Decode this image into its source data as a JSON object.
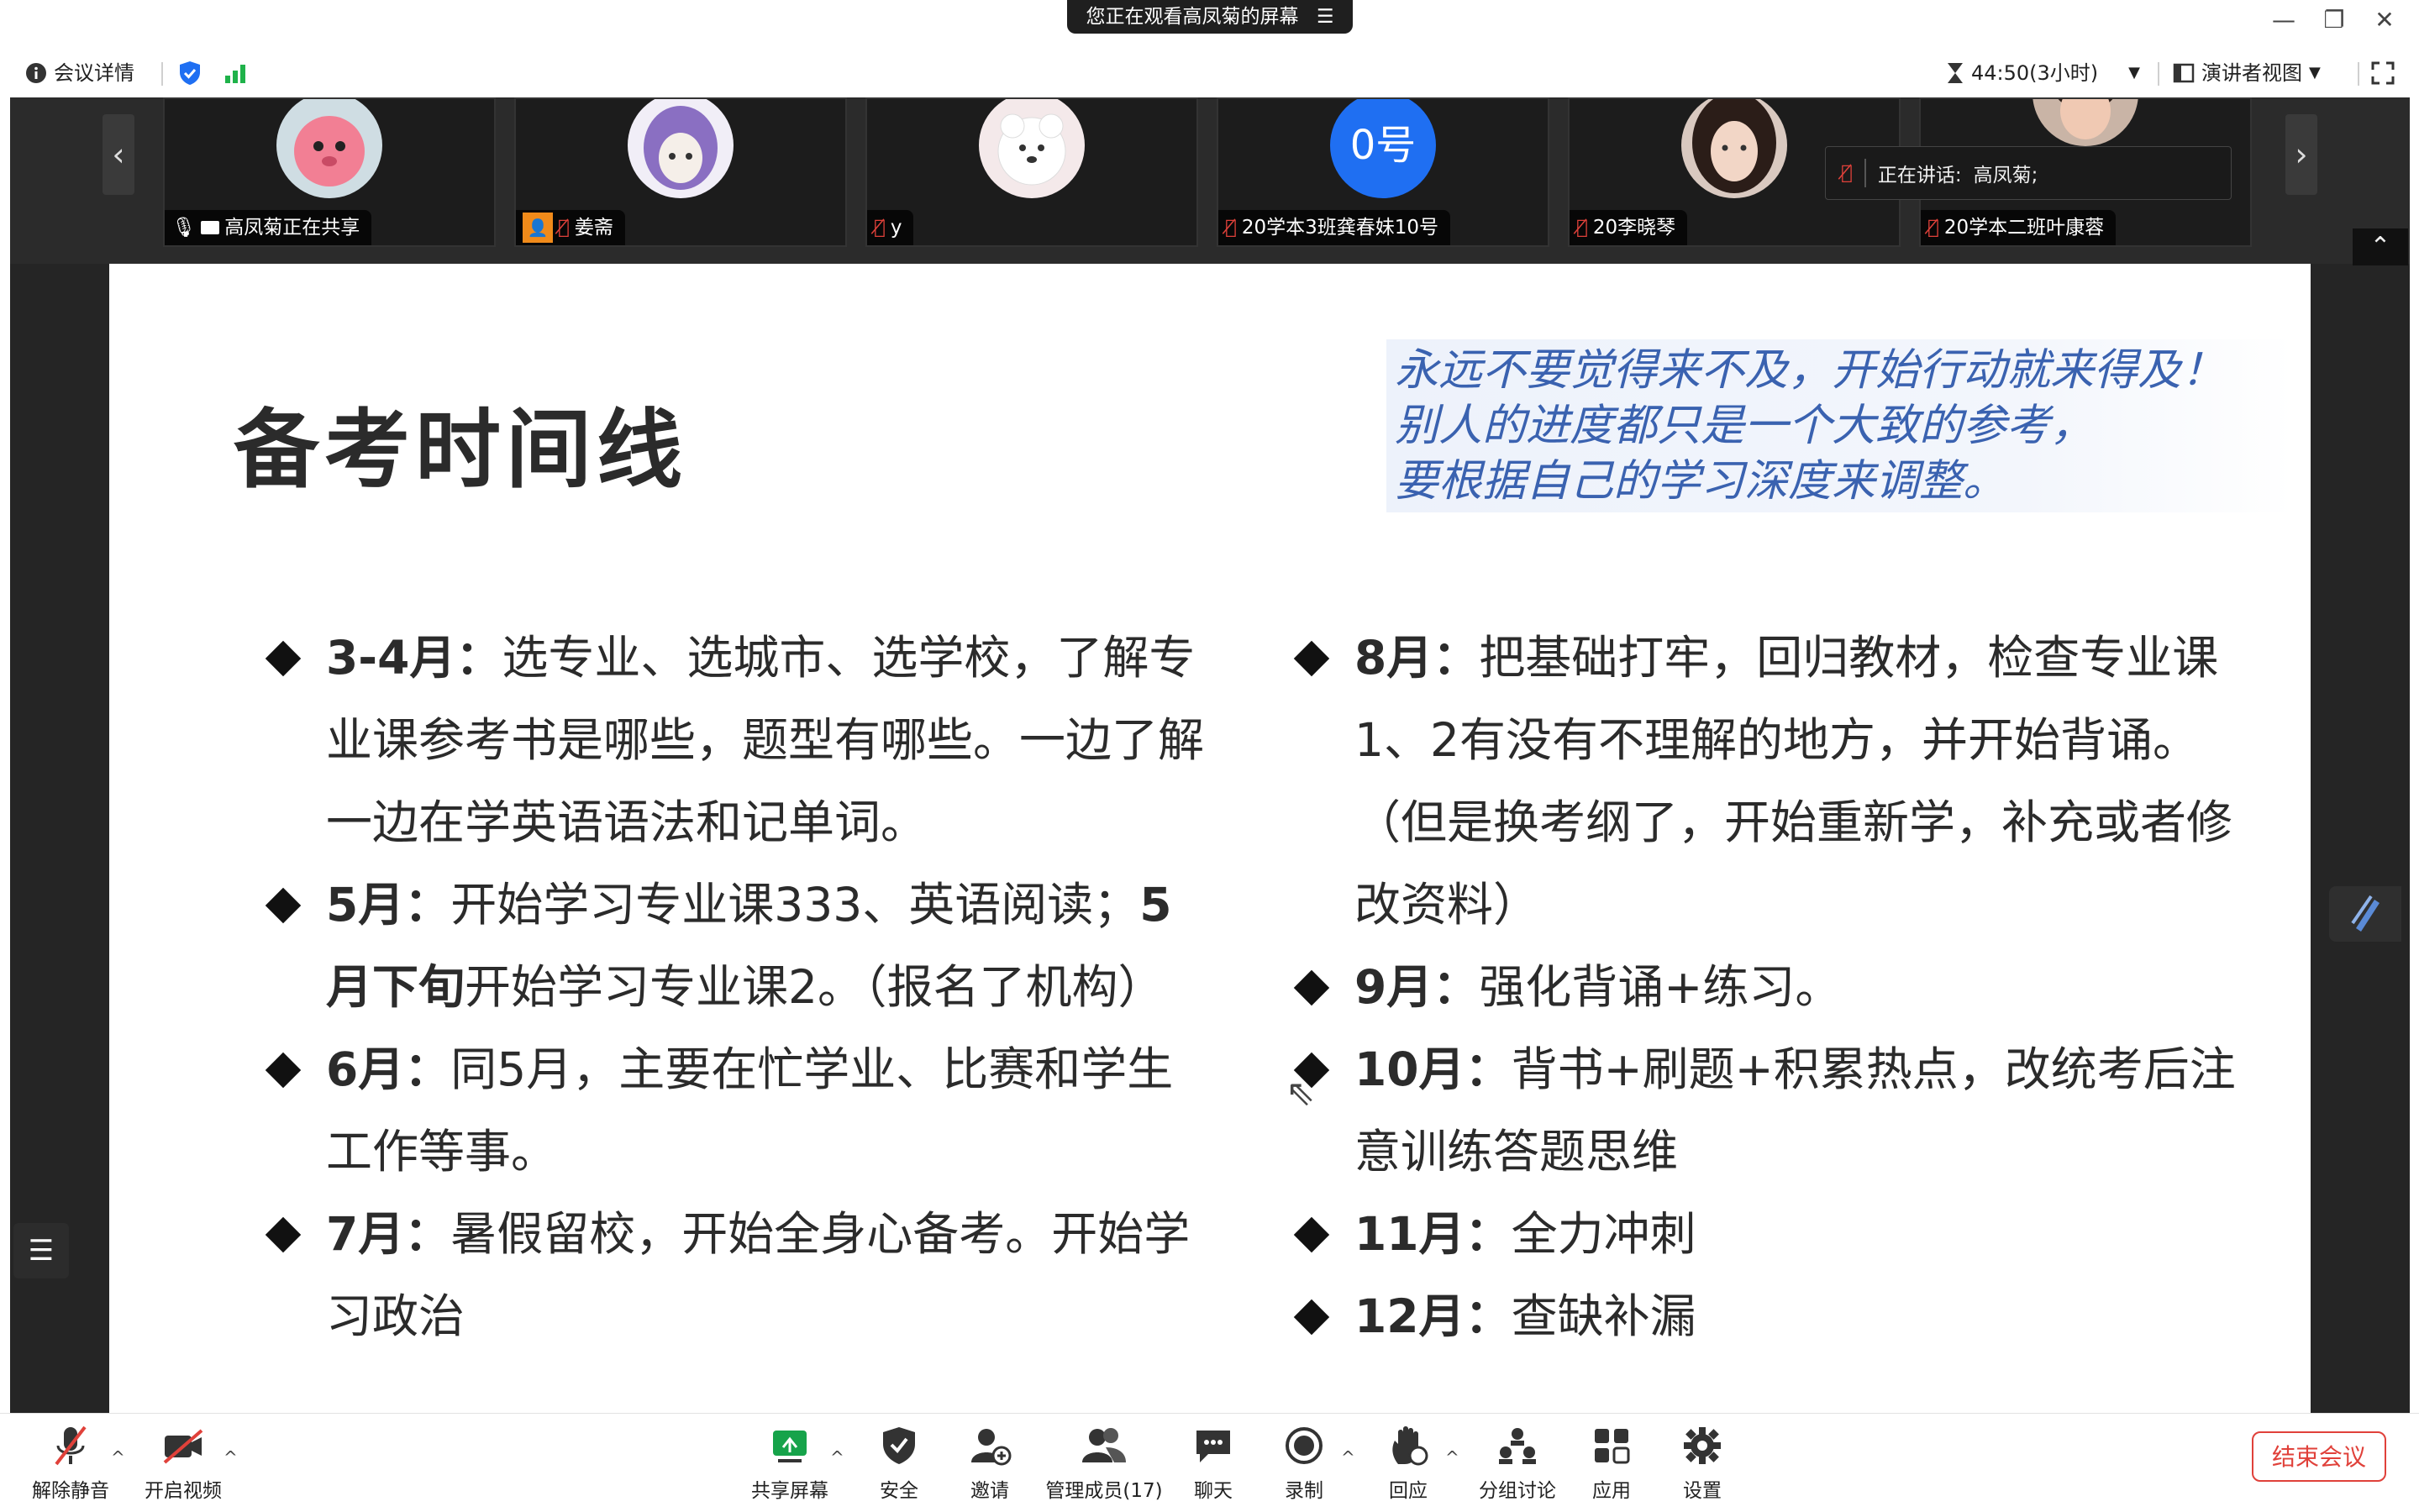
{
  "window": {
    "share_notice": "您正在观看高凤菊的屏幕",
    "minimize": "—",
    "restore": "❐",
    "close": "✕"
  },
  "infobar": {
    "meeting_details": "会议详情",
    "timer": "44:50(3小时)",
    "view_mode": "演讲者视图"
  },
  "participants": [
    {
      "name": "高凤菊正在共享",
      "avatar": "pink-creature"
    },
    {
      "name": "姜斋",
      "avatar": "anime-girl"
    },
    {
      "name": "y",
      "avatar": "white-dog"
    },
    {
      "name": "20学本3班龚春妹10号",
      "avatar": "text-0hao",
      "avatar_text": "0号"
    },
    {
      "name": "20李晓琴",
      "avatar": "photo-girl"
    },
    {
      "name": "20学本二班叶康蓉",
      "avatar": "photo-boy"
    }
  ],
  "speaking": {
    "label": "正在讲话:",
    "name": "高凤菊;"
  },
  "slide": {
    "title": "备考时间线",
    "quote": [
      "永远不要觉得来不及，开始行动就来得及！",
      "别人的进度都只是一个大致的参考，",
      "要根据自己的学习深度来调整。"
    ],
    "left_items": [
      {
        "month": "3-4月",
        "sep": "：",
        "text": "选专业、选城市、选学校，了解专业课参考书是哪些，题型有哪些。一边了解一边在学英语语法和记单词。"
      },
      {
        "month": "5月",
        "sep": "：",
        "text": "开始学习专业课333、英语阅读；",
        "extra_bold": "5月下旬",
        "extra_text": "开始学习专业课2。（报名了机构）"
      },
      {
        "month": "6月",
        "sep": "：",
        "text": "同5月，主要在忙学业、比赛和学生工作等事。"
      },
      {
        "month": "7月",
        "sep": "：",
        "text": "暑假留校，开始全身心备考。开始学习政治"
      }
    ],
    "right_items": [
      {
        "month": "8月",
        "sep": "：",
        "text": "把基础打牢，回归教材，检查专业课1、2有没有不理解的地方，并开始背诵。（但是换考纲了，开始重新学，补充或者修改资料）"
      },
      {
        "month": "9月",
        "sep": "：",
        "text": "强化背诵+练习。"
      },
      {
        "month": "10月",
        "sep": "：",
        "text": "背书+刷题+积累热点，改统考后注意训练答题思维"
      },
      {
        "month": "11月",
        "sep": "：",
        "text": "全力冲刺"
      },
      {
        "month": "12月",
        "sep": "：",
        "text": "查缺补漏"
      }
    ]
  },
  "toolbar": {
    "unmute": "解除静音",
    "start_video": "开启视频",
    "share_screen": "共享屏幕",
    "security": "安全",
    "invite": "邀请",
    "manage_members": "管理成员(17)",
    "chat": "聊天",
    "record": "录制",
    "react": "回应",
    "breakout": "分组讨论",
    "apps": "应用",
    "settings": "设置",
    "end_meeting": "结束会议"
  },
  "colors": {
    "accent_blue": "#1f6ff2",
    "signal_green": "#1fb24a",
    "end_red": "#e0413a",
    "share_green": "#16a34a",
    "quote_blue": "#3a62b0"
  }
}
